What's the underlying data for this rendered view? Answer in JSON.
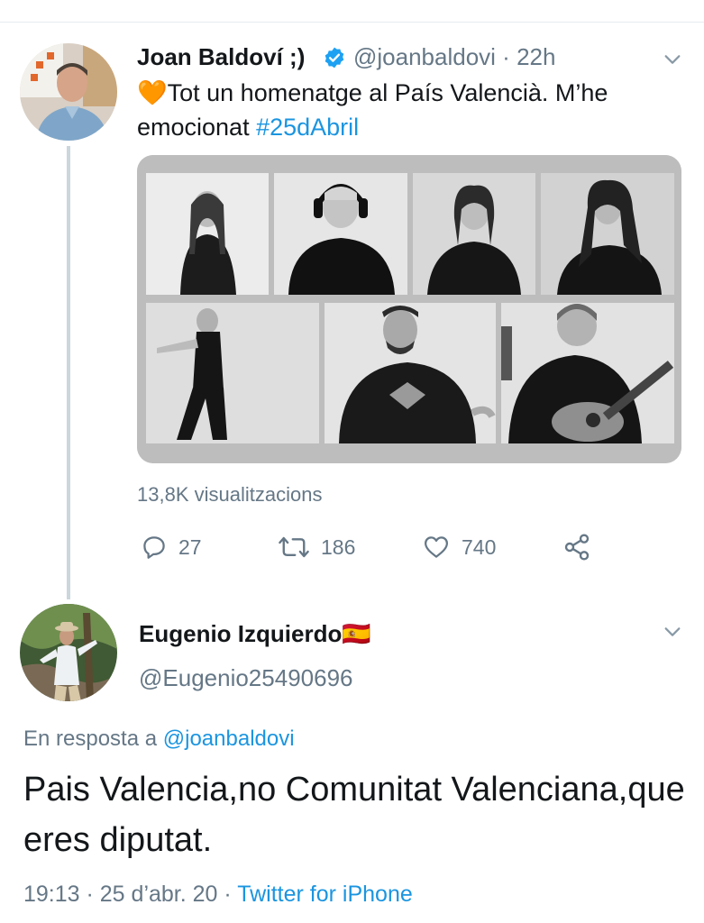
{
  "tweet": {
    "author_name": "Joan Baldoví ;)",
    "handle": "@joanbaldovi",
    "separator": " · ",
    "time": "22h",
    "text_emoji": "🧡",
    "text": "Tot un homenatge al País Valencià. M’he emocionat ",
    "hashtag": "#25dAbril",
    "views": "13,8K visualitzacions",
    "actions": {
      "replies": "27",
      "retweets": "186",
      "likes": "740"
    }
  },
  "reply": {
    "author_name": "Eugenio Izquierdo",
    "flag_emoji": "🇪🇸",
    "handle": "@Eugenio25490696",
    "reply_to_prefix": "En resposta a ",
    "reply_to_handle": "@joanbaldovi",
    "text": "Pais Valencia,no Comunitat Valenciana,que eres diputat.",
    "time": "19:13",
    "date": "25 d’abr. 20",
    "meta_separator": " · ",
    "source": "Twitter for iPhone"
  },
  "colors": {
    "link": "#1b95e0",
    "secondary_text": "#657786",
    "verified": "#1da1f2",
    "thread_line": "#ccd6dd"
  },
  "icons": [
    "verified-badge-icon",
    "chevron-down-icon",
    "reply-icon",
    "retweet-icon",
    "like-icon",
    "share-icon"
  ]
}
